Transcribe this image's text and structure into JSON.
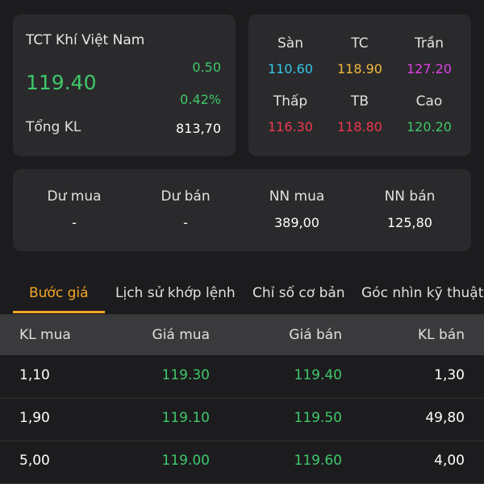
{
  "quote": {
    "company": "TCT Khí Việt Nam",
    "price": "119.40",
    "change": "0.50",
    "change_pct": "0.42%",
    "volume_label": "Tổng KL",
    "volume_value": "813,70"
  },
  "range": {
    "floor": {
      "label": "Sàn",
      "value": "110.60",
      "color": "#35c6e8"
    },
    "reference": {
      "label": "TC",
      "value": "118.90",
      "color": "#f5b83d"
    },
    "ceiling": {
      "label": "Trần",
      "value": "127.20",
      "color": "#e040e8"
    },
    "low": {
      "label": "Thấp",
      "value": "116.30",
      "color": "#f0384d"
    },
    "average": {
      "label": "TB",
      "value": "118.80",
      "color": "#f0384d"
    },
    "high": {
      "label": "Cao",
      "value": "120.20",
      "color": "#3fc86a"
    }
  },
  "foreign": {
    "bid_surplus": {
      "label": "Dư mua",
      "value": "-"
    },
    "ask_surplus": {
      "label": "Dư bán",
      "value": "-"
    },
    "foreign_buy": {
      "label": "NN mua",
      "value": "389,00"
    },
    "foreign_sell": {
      "label": "NN bán",
      "value": "125,80"
    }
  },
  "tabs": [
    {
      "label": "Bước giá",
      "active": true
    },
    {
      "label": "Lịch sử khớp lệnh",
      "active": false
    },
    {
      "label": "Chỉ số cơ bản",
      "active": false
    },
    {
      "label": "Góc nhìn kỹ thuật",
      "active": false
    }
  ],
  "order_book": {
    "headers": [
      "KL mua",
      "Giá mua",
      "Giá bán",
      "KL bán"
    ],
    "rows": [
      [
        "1,10",
        "119.30",
        "119.40",
        "1,30"
      ],
      [
        "1,90",
        "119.10",
        "119.50",
        "49,80"
      ],
      [
        "5,00",
        "119.00",
        "119.60",
        "4,00"
      ]
    ]
  },
  "colors": {
    "accent": "#f5a623",
    "up": "#3fc86a"
  }
}
